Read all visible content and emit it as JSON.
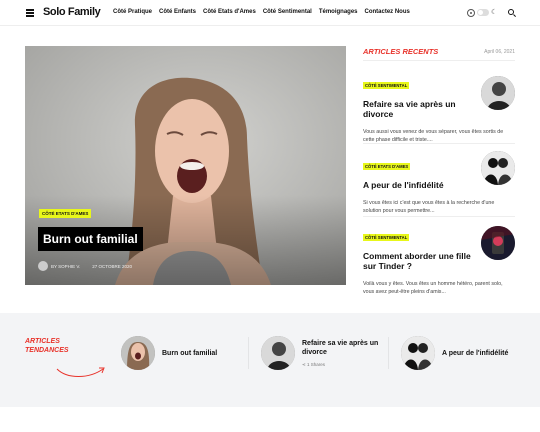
{
  "site": {
    "logo": "Solo Family"
  },
  "nav": [
    "Côté Pratique",
    "Côté Enfants",
    "Côté Etats d'Ames",
    "Côté Sentimental",
    "Témoignages",
    "Contactez Nous"
  ],
  "header_icons": [
    "menu-icon",
    "sun-icon",
    "toggle",
    "moon-icon",
    "search-icon"
  ],
  "hero": {
    "category": "Côté Etats d'Ames",
    "title": "Burn out familial",
    "author": "By Sophie V.",
    "date": "27 Octobre 2020"
  },
  "recent": {
    "title": "Articles Recents",
    "date": "April 06, 2021",
    "items": [
      {
        "category": "Côté Sentimental",
        "title": "Refaire sa vie après un divorce",
        "excerpt": "Vous aussi vous venez de vous séparer, vous êtes sortis de cette phase difficile et triste...."
      },
      {
        "category": "Côté Etats d'Ames",
        "title": "A peur de l'infidélité",
        "excerpt": "Si vous êtes ici c'est que vous êtes à la recherche d'une solution pour vous permettre..."
      },
      {
        "category": "Côté Sentimental",
        "title": "Comment aborder une fille sur Tinder ?",
        "excerpt": "Voilà vous y êtes. Vous êtes un homme hétéro, parent solo, vous avez peut-être pleins d'amis..."
      }
    ]
  },
  "trending": {
    "title_line1": "Articles",
    "title_line2": "Tendances",
    "items": [
      {
        "title": "Burn out familial",
        "shares": ""
      },
      {
        "title": "Refaire sa vie après un divorce",
        "shares": "1 Shares"
      },
      {
        "title": "A peur de l'infidélité",
        "shares": ""
      }
    ]
  },
  "colors": {
    "accent": "#e8322a",
    "highlight": "#e8f71a"
  }
}
